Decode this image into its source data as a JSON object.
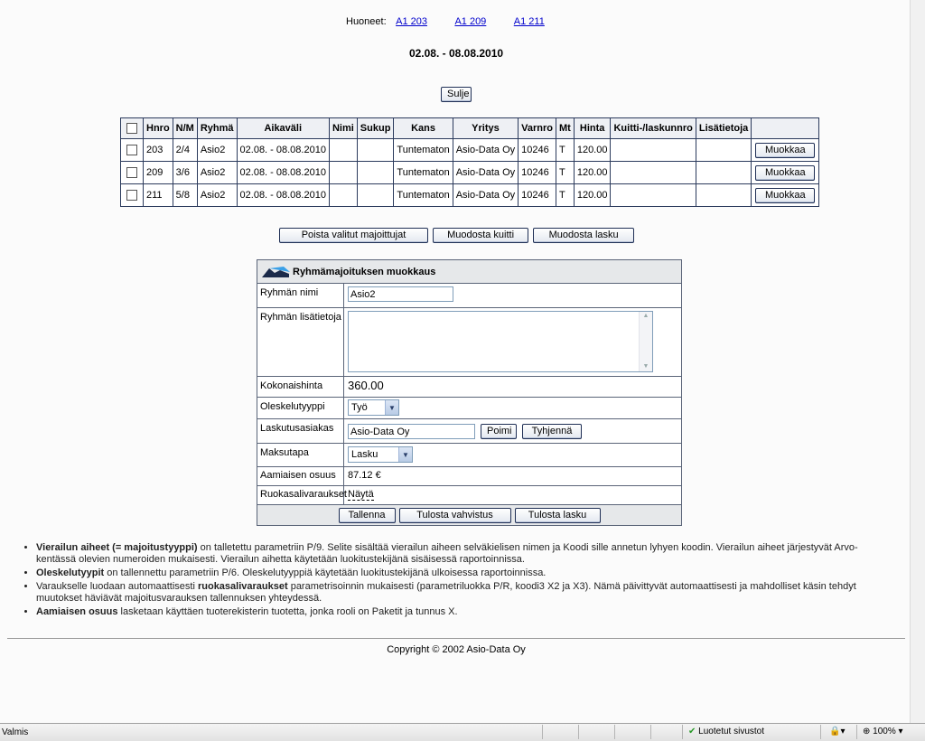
{
  "rooms_label": "Huoneet:",
  "rooms": [
    "A1 203",
    "A1 209",
    "A1 211"
  ],
  "date_range": "02.08. - 08.08.2010",
  "close_button": "Sulje",
  "table": {
    "headers": [
      "Hnro",
      "N/M",
      "Ryhmä",
      "Aikaväli",
      "Nimi",
      "Sukup",
      "Kans",
      "Yritys",
      "Varnro",
      "Mt",
      "Hinta",
      "Kuitti-/laskunnro",
      "Lisätietoja"
    ],
    "rows": [
      {
        "hnro": "203",
        "nm": "2/4",
        "ryhma": "Asio2",
        "aikavali": "02.08. - 08.08.2010",
        "nimi": "",
        "sukup": "",
        "kans": "Tuntematon",
        "yritys": "Asio-Data Oy",
        "varnro": "10246",
        "mt": "T",
        "hinta": "120.00",
        "kuitti": "",
        "lisatietoja": ""
      },
      {
        "hnro": "209",
        "nm": "3/6",
        "ryhma": "Asio2",
        "aikavali": "02.08. - 08.08.2010",
        "nimi": "",
        "sukup": "",
        "kans": "Tuntematon",
        "yritys": "Asio-Data Oy",
        "varnro": "10246",
        "mt": "T",
        "hinta": "120.00",
        "kuitti": "",
        "lisatietoja": ""
      },
      {
        "hnro": "211",
        "nm": "5/8",
        "ryhma": "Asio2",
        "aikavali": "02.08. - 08.08.2010",
        "nimi": "",
        "sukup": "",
        "kans": "Tuntematon",
        "yritys": "Asio-Data Oy",
        "varnro": "10246",
        "mt": "T",
        "hinta": "120.00",
        "kuitti": "",
        "lisatietoja": ""
      }
    ],
    "edit_label": "Muokkaa"
  },
  "actions": {
    "delete_selected": "Poista valitut majoittujat",
    "create_receipt": "Muodosta kuitti",
    "create_invoice": "Muodosta lasku"
  },
  "form": {
    "title": "Ryhmämajoituksen muokkaus",
    "group_name_label": "Ryhmän nimi",
    "group_name_value": "Asio2",
    "group_info_label": "Ryhmän lisätietoja",
    "group_info_value": "",
    "total_price_label": "Kokonaishinta",
    "total_price_value": "360.00",
    "stay_type_label": "Oleskelutyyppi",
    "stay_type_value": "Työ",
    "billing_customer_label": "Laskutusasiakas",
    "billing_customer_value": "Asio-Data Oy",
    "pick_button": "Poimi",
    "clear_button": "Tyhjennä",
    "payment_method_label": "Maksutapa",
    "payment_method_value": "Lasku",
    "breakfast_share_label": "Aamiaisen osuus",
    "breakfast_share_value": "87.12 €",
    "restaurant_label": "Ruokasalivaraukset",
    "restaurant_link": "Näytä",
    "save_button": "Tallenna",
    "print_confirmation_button": "Tulosta vahvistus",
    "print_invoice_button": "Tulosta lasku"
  },
  "help": [
    {
      "bold": "Vierailun aiheet (= majoitustyyppi)",
      "text": " on talletettu parametriin P/9. Selite sisältää vierailun aiheen selväkielisen nimen ja Koodi sille annetun lyhyen koodin. Vierailun aiheet järjestyvät Arvo-kentässä olevien numeroiden mukaisesti. Vierailun aihetta käytetään luokitustekijänä sisäisessä raportoinnissa."
    },
    {
      "bold": "Oleskelutyypit",
      "text": " on tallennettu parametriin P/6. Oleskelutyyppiä käytetään luokitustekijänä ulkoisessa raportoinnissa."
    },
    {
      "pre": "Varaukselle luodaan automaattisesti ",
      "bold": "ruokasalivaraukset",
      "text": " parametrisoinnin mukaisesti (parametriluokka P/R, koodi3 X2 ja X3). Nämä päivittyvät automaattisesti ja mahdolliset käsin tehdyt muutokset häviävät majoitusvarauksen tallennuksen yhteydessä."
    },
    {
      "bold": "Aamiaisen osuus",
      "text": " lasketaan käyttäen tuoterekisterin tuotetta, jonka rooli on Paketit ja tunnus X."
    }
  ],
  "copyright": "Copyright © 2002 Asio-Data Oy",
  "statusbar": {
    "status": "Valmis",
    "zone": "Luotetut sivustot",
    "zoom": "100%"
  }
}
